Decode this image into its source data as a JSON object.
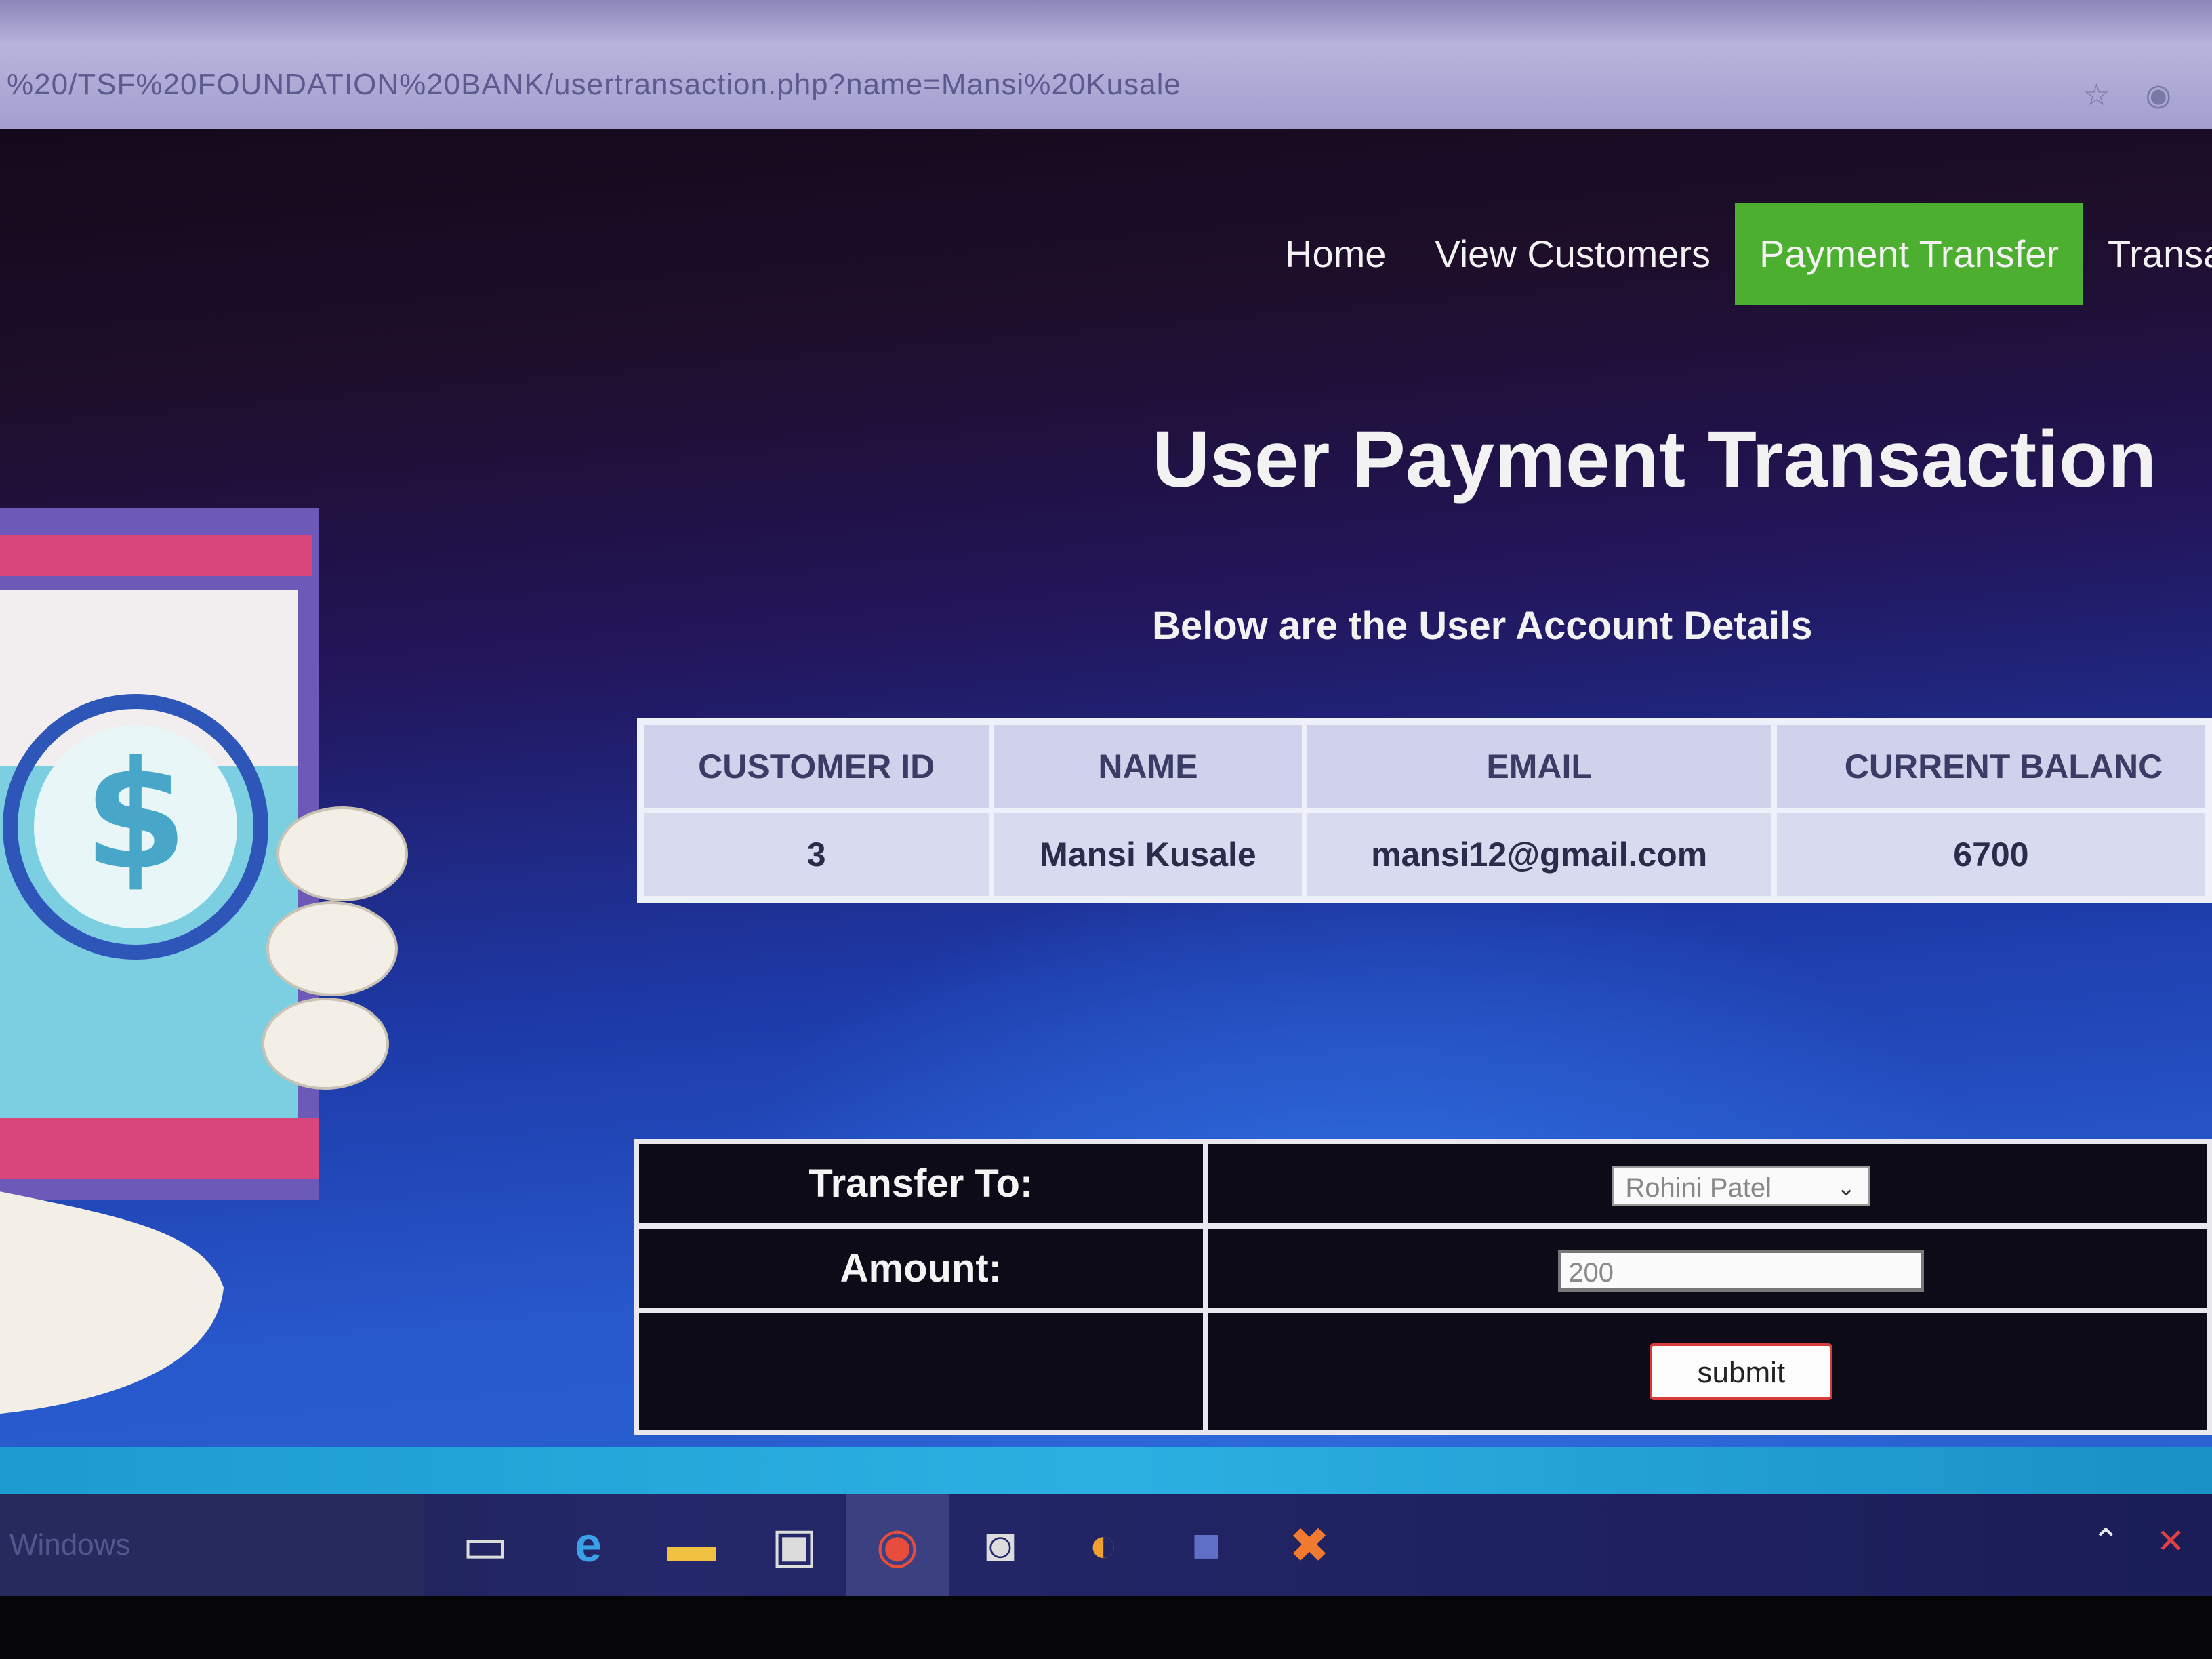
{
  "browser": {
    "url": "%20/TSF%20FOUNDATION%20BANK/usertransaction.php?name=Mansi%20Kusale"
  },
  "nav": {
    "items": [
      {
        "label": "Home",
        "active": false
      },
      {
        "label": "View Customers",
        "active": false
      },
      {
        "label": "Payment Transfer",
        "active": true
      },
      {
        "label": "Transactio",
        "active": false
      }
    ],
    "active_color": "#4caf2f"
  },
  "main": {
    "title": "User Payment Transaction",
    "subtitle": "Below are the User Account Details",
    "table": {
      "headers": [
        "CUSTOMER ID",
        "NAME",
        "EMAIL",
        "CURRENT BALANC"
      ],
      "row": [
        "3",
        "Mansi Kusale",
        "mansi12@gmail.com",
        "6700"
      ]
    },
    "form": {
      "transfer_label": "Transfer To:",
      "transfer_value": "Rohini Patel",
      "amount_label": "Amount:",
      "amount_value": "200",
      "submit_label": "submit"
    }
  },
  "taskbar": {
    "search_text": "Windows",
    "icons": [
      "task-view-icon",
      "edge-icon",
      "file-explorer-icon",
      "display-icon",
      "chrome-icon",
      "camera-icon",
      "eclipse-icon",
      "app-icon",
      "xampp-icon"
    ],
    "active_icon": "chrome-icon"
  }
}
